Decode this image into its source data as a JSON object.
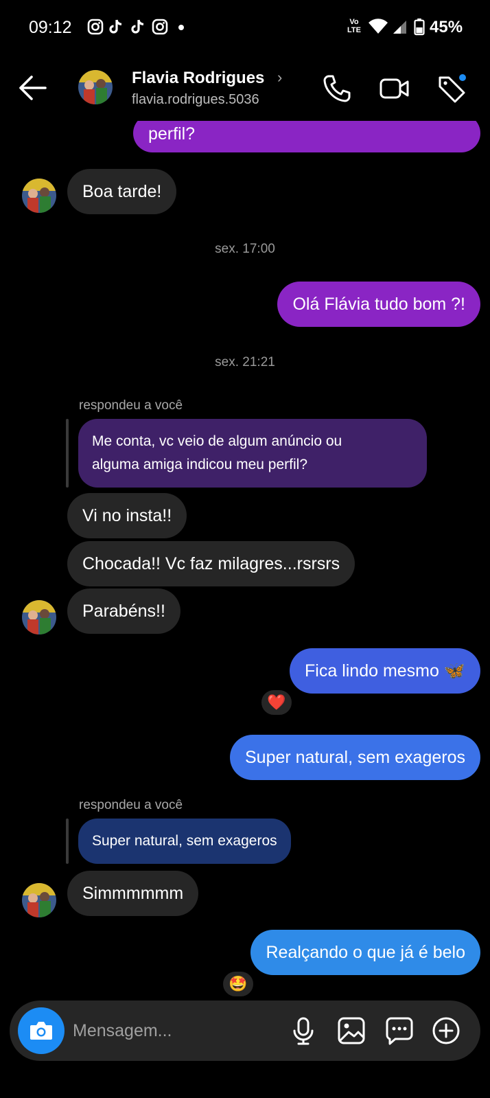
{
  "status_bar": {
    "time": "09:12",
    "network_label_top": "Vo",
    "network_label_bottom": "LTE",
    "battery": "45%"
  },
  "header": {
    "contact_name": "Flavia Rodrigues",
    "contact_username": "flavia.rodrigues.5036",
    "chevron": "›"
  },
  "messages": {
    "m1": "perfil?",
    "m2": "Boa tarde!",
    "ts1": "sex. 17:00",
    "m3": "Olá Flávia tudo bom ?!",
    "ts2": "sex. 21:21",
    "reply1_note": "respondeu a você",
    "reply1_quote_line1": "Me conta, vc veio de algum anúncio ou",
    "reply1_quote_line2": "alguma amiga indicou meu perfil?",
    "m4": "Vi no insta!!",
    "m5": "Chocada!! Vc faz milagres...rsrsrs",
    "m6": "Parabéns!!",
    "m7": "Fica lindo mesmo 🦋",
    "m7_reaction": "❤️",
    "m8": "Super natural, sem exageros",
    "reply2_note": "respondeu a você",
    "reply2_quote": "Super natural, sem exageros",
    "m9": "Simmmmmm",
    "m10": "Realçando o que já é belo",
    "m10_reaction": "🤩"
  },
  "composer": {
    "placeholder": "Mensagem..."
  },
  "colors": {
    "outgoing_purple": "#8a25c4",
    "outgoing_blue": "#3f5fe0",
    "incoming": "#262626",
    "camera_button": "#1c8cf4",
    "notification_dot": "#1c8cf4"
  },
  "icons": {
    "status": [
      "instagram-icon",
      "tiktok-icon",
      "tiktok-icon",
      "instagram-icon",
      "wifi-icon",
      "signal-icon",
      "battery-icon"
    ],
    "header": [
      "back-arrow-icon",
      "phone-icon",
      "video-icon",
      "tag-icon"
    ],
    "composer": [
      "camera-icon",
      "microphone-icon",
      "image-icon",
      "sticker-icon",
      "plus-icon"
    ]
  }
}
